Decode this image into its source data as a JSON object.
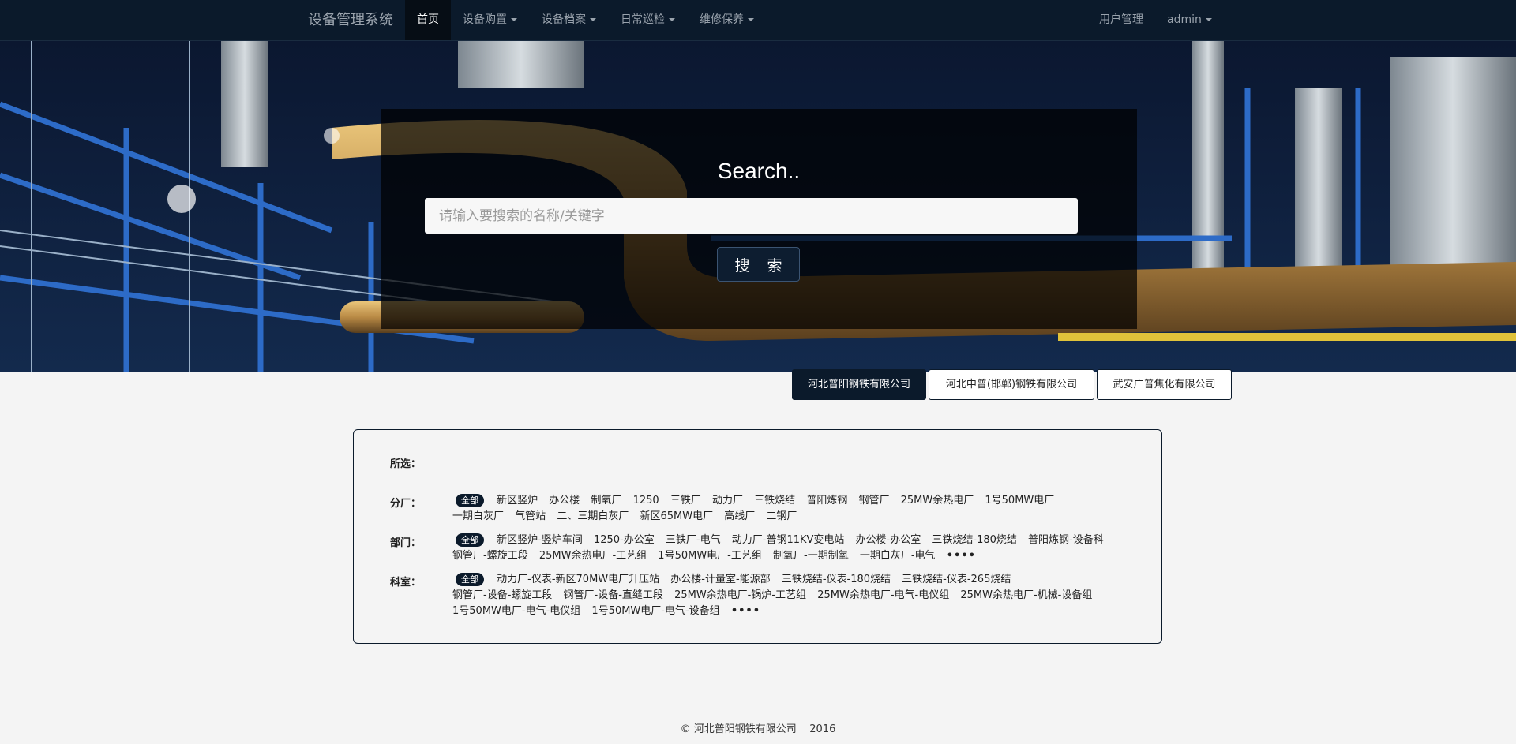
{
  "navbar": {
    "brand": "设备管理系统",
    "items": [
      {
        "label": "首页"
      },
      {
        "label": "设备购置"
      },
      {
        "label": "设备档案"
      },
      {
        "label": "日常巡检"
      },
      {
        "label": "维修保养"
      }
    ],
    "right": [
      {
        "label": "用户管理"
      },
      {
        "label": "admin"
      }
    ]
  },
  "hero": {
    "title": "Search..",
    "placeholder": "请输入要搜索的名称/关键字",
    "button": "搜 索"
  },
  "companies": [
    {
      "label": "河北普阳钢铁有限公司",
      "active": true
    },
    {
      "label": "河北中普(邯郸)钢铁有限公司",
      "active": false
    },
    {
      "label": "武安广普焦化有限公司",
      "active": false
    }
  ],
  "filter": {
    "selected_label": "所选：",
    "all_label": "全部",
    "more_label": "••••",
    "rows": {
      "branch": {
        "label": "分厂：",
        "items": [
          "新区竖炉",
          "办公楼",
          "制氧厂",
          "1250",
          "三铁厂",
          "动力厂",
          "三铁烧结",
          "普阳炼钢",
          "钢管厂",
          "25MW余热电厂",
          "1号50MW电厂",
          "一期白灰厂",
          "气管站",
          "二、三期白灰厂",
          "新区65MW电厂",
          "高线厂",
          "二钢厂"
        ]
      },
      "department": {
        "label": "部门：",
        "items": [
          "新区竖炉-竖炉车间",
          "1250-办公室",
          "三铁厂-电气",
          "动力厂-普钢11KV变电站",
          "办公楼-办公室",
          "三铁烧结-180烧结",
          "普阳炼钢-设备科",
          "钢管厂-螺旋工段",
          "25MW余热电厂-工艺组",
          "1号50MW电厂-工艺组",
          "制氧厂-一期制氧",
          "一期白灰厂-电气"
        ]
      },
      "section": {
        "label": "科室：",
        "items": [
          "动力厂-仪表-新区70MW电厂升压站",
          "办公楼-计量室-能源部",
          "三铁烧结-仪表-180烧结",
          "三铁烧结-仪表-265烧结",
          "钢管厂-设备-螺旋工段",
          "钢管厂-设备-直缝工段",
          "25MW余热电厂-锅炉-工艺组",
          "25MW余热电厂-电气-电仪组",
          "25MW余热电厂-机械-设备组",
          "1号50MW电厂-电气-电仪组",
          "1号50MW电厂-电气-设备组"
        ]
      }
    }
  },
  "footer": {
    "text": "© 河北普阳钢铁有限公司    2016"
  },
  "colors": {
    "navbar": "#0b1a2b",
    "accent": "#0b1a2b",
    "background": "#f4f4f4"
  }
}
